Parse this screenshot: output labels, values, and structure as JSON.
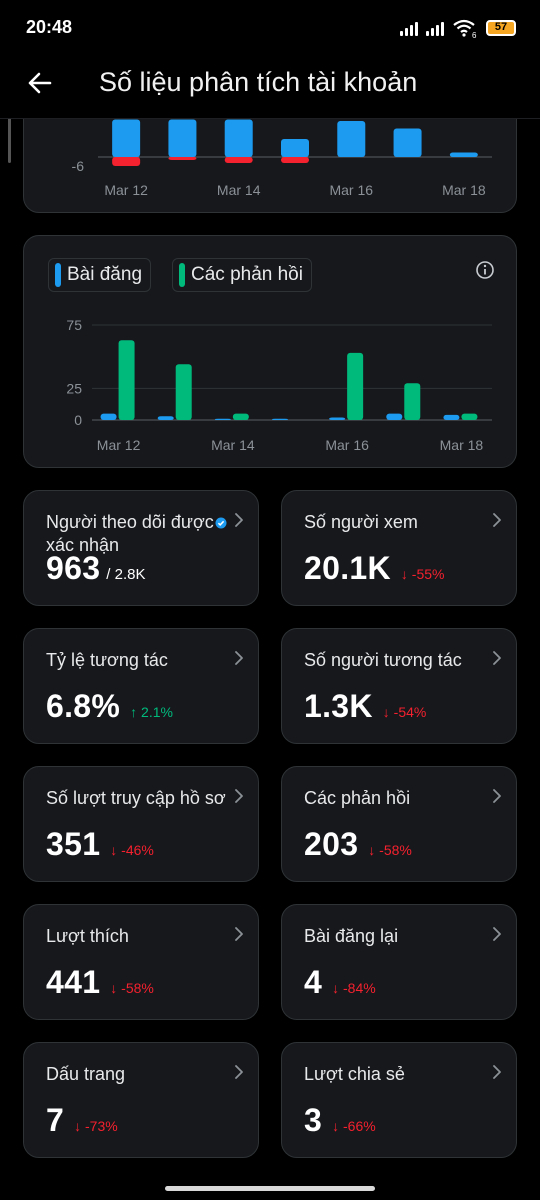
{
  "status_bar": {
    "time": "20:48",
    "battery": "57",
    "wifi_badge": "6"
  },
  "header": {
    "title": "Số liệu phân tích tài khoản"
  },
  "icons": {
    "back": "arrow-left-icon",
    "info": "info-icon",
    "chevron": "chevron-right-icon",
    "verified": "verified-badge-icon",
    "wifi": "wifi-icon",
    "signal": "cell-signal-icon",
    "battery": "battery-icon"
  },
  "colors": {
    "background": "#000000",
    "card": "#16181c",
    "blue": "#1d9bf0",
    "green": "#00ba7c",
    "red": "#f4212e"
  },
  "chart_data": [
    {
      "type": "bar",
      "categories": [
        "Mar 12",
        "Mar 13",
        "Mar 14",
        "Mar 15",
        "Mar 16",
        "Mar 17",
        "Mar 18"
      ],
      "x_tick_labels": [
        "Mar 12",
        "Mar 14",
        "Mar 16",
        "Mar 18"
      ],
      "y_tick_labels": [
        "-6"
      ],
      "series": [
        {
          "values": [
            25,
            25,
            25,
            12,
            24,
            19,
            3
          ],
          "color": "#1d9bf0"
        },
        {
          "values": [
            -6,
            -2,
            -4,
            -4,
            0,
            0,
            0
          ],
          "color": "#f4212e"
        }
      ],
      "ylim": [
        -9,
        26
      ],
      "grid": true
    },
    {
      "type": "bar",
      "categories": [
        "Mar 12",
        "Mar 13",
        "Mar 14",
        "Mar 15",
        "Mar 16",
        "Mar 17",
        "Mar 18"
      ],
      "x_tick_labels": [
        "Mar 12",
        "Mar 14",
        "Mar 16",
        "Mar 18"
      ],
      "y_tick_labels": [
        "75",
        "25",
        "0"
      ],
      "series": [
        {
          "name": "Bài đăng",
          "values": [
            5,
            3,
            1,
            1,
            2,
            5,
            4
          ],
          "color": "#1d9bf0"
        },
        {
          "name": "Các phản hồi",
          "values": [
            63,
            44,
            5,
            0,
            53,
            29,
            5
          ],
          "color": "#00ba7c"
        }
      ],
      "ylim": [
        0,
        80
      ],
      "grid": true,
      "legend": "top-left"
    }
  ],
  "stats": [
    {
      "label": "Người theo dõi được xác nhận",
      "value": "963",
      "sub": "/ 2.8K",
      "change": "",
      "direction": "none",
      "verified": true
    },
    {
      "label": "Số người xem",
      "value": "20.1K",
      "change": "↓ -55%",
      "direction": "down"
    },
    {
      "label": "Tỷ lệ tương tác",
      "value": "6.8%",
      "change": "↑ 2.1%",
      "direction": "up"
    },
    {
      "label": "Số người tương tác",
      "value": "1.3K",
      "change": "↓ -54%",
      "direction": "down"
    },
    {
      "label": "Số lượt truy cập hồ sơ",
      "value": "351",
      "change": "↓ -46%",
      "direction": "down"
    },
    {
      "label": "Các phản hồi",
      "value": "203",
      "change": "↓ -58%",
      "direction": "down"
    },
    {
      "label": "Lượt thích",
      "value": "441",
      "change": "↓ -58%",
      "direction": "down"
    },
    {
      "label": "Bài đăng lại",
      "value": "4",
      "change": "↓ -84%",
      "direction": "down"
    },
    {
      "label": "Dấu trang",
      "value": "7",
      "change": "↓ -73%",
      "direction": "down"
    },
    {
      "label": "Lượt chia sẻ",
      "value": "3",
      "change": "↓ -66%",
      "direction": "down"
    }
  ]
}
